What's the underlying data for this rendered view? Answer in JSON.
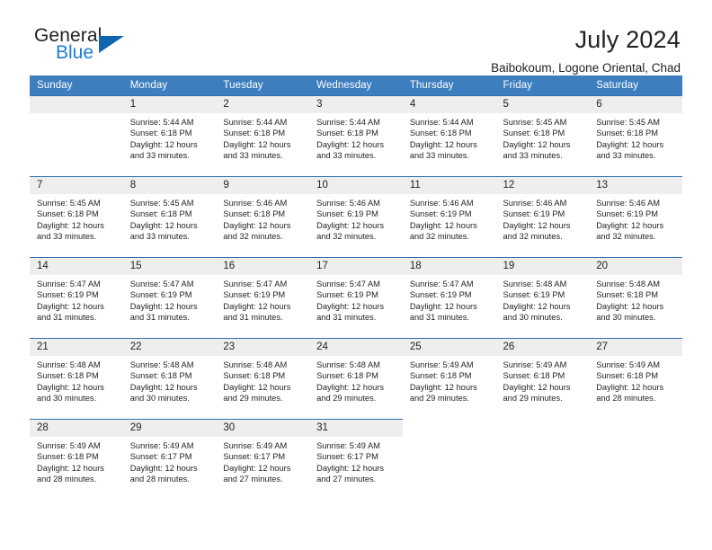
{
  "brand": {
    "name_part1": "General",
    "name_part2": "Blue",
    "triangle_color": "#1065ad",
    "blue_color": "#1a7fd4"
  },
  "header": {
    "title": "July 2024",
    "subtitle": "Baibokoum, Logone Oriental, Chad"
  },
  "theme": {
    "header_row_bg": "#3d7ebf",
    "day_number_bg": "#eeeeee",
    "row_border": "#2f6fb0"
  },
  "labels": {
    "sunrise_prefix": "Sunrise: ",
    "sunset_prefix": "Sunset: ",
    "daylight_prefix": "Daylight: "
  },
  "weekdays": [
    "Sunday",
    "Monday",
    "Tuesday",
    "Wednesday",
    "Thursday",
    "Friday",
    "Saturday"
  ],
  "weeks": [
    [
      {
        "day": "",
        "empty": true
      },
      {
        "day": "1",
        "sunrise": "Sunrise: 5:44 AM",
        "sunset": "Sunset: 6:18 PM",
        "daylight": "Daylight: 12 hours and 33 minutes."
      },
      {
        "day": "2",
        "sunrise": "Sunrise: 5:44 AM",
        "sunset": "Sunset: 6:18 PM",
        "daylight": "Daylight: 12 hours and 33 minutes."
      },
      {
        "day": "3",
        "sunrise": "Sunrise: 5:44 AM",
        "sunset": "Sunset: 6:18 PM",
        "daylight": "Daylight: 12 hours and 33 minutes."
      },
      {
        "day": "4",
        "sunrise": "Sunrise: 5:44 AM",
        "sunset": "Sunset: 6:18 PM",
        "daylight": "Daylight: 12 hours and 33 minutes."
      },
      {
        "day": "5",
        "sunrise": "Sunrise: 5:45 AM",
        "sunset": "Sunset: 6:18 PM",
        "daylight": "Daylight: 12 hours and 33 minutes."
      },
      {
        "day": "6",
        "sunrise": "Sunrise: 5:45 AM",
        "sunset": "Sunset: 6:18 PM",
        "daylight": "Daylight: 12 hours and 33 minutes."
      }
    ],
    [
      {
        "day": "7",
        "sunrise": "Sunrise: 5:45 AM",
        "sunset": "Sunset: 6:18 PM",
        "daylight": "Daylight: 12 hours and 33 minutes."
      },
      {
        "day": "8",
        "sunrise": "Sunrise: 5:45 AM",
        "sunset": "Sunset: 6:18 PM",
        "daylight": "Daylight: 12 hours and 33 minutes."
      },
      {
        "day": "9",
        "sunrise": "Sunrise: 5:46 AM",
        "sunset": "Sunset: 6:18 PM",
        "daylight": "Daylight: 12 hours and 32 minutes."
      },
      {
        "day": "10",
        "sunrise": "Sunrise: 5:46 AM",
        "sunset": "Sunset: 6:19 PM",
        "daylight": "Daylight: 12 hours and 32 minutes."
      },
      {
        "day": "11",
        "sunrise": "Sunrise: 5:46 AM",
        "sunset": "Sunset: 6:19 PM",
        "daylight": "Daylight: 12 hours and 32 minutes."
      },
      {
        "day": "12",
        "sunrise": "Sunrise: 5:46 AM",
        "sunset": "Sunset: 6:19 PM",
        "daylight": "Daylight: 12 hours and 32 minutes."
      },
      {
        "day": "13",
        "sunrise": "Sunrise: 5:46 AM",
        "sunset": "Sunset: 6:19 PM",
        "daylight": "Daylight: 12 hours and 32 minutes."
      }
    ],
    [
      {
        "day": "14",
        "sunrise": "Sunrise: 5:47 AM",
        "sunset": "Sunset: 6:19 PM",
        "daylight": "Daylight: 12 hours and 31 minutes."
      },
      {
        "day": "15",
        "sunrise": "Sunrise: 5:47 AM",
        "sunset": "Sunset: 6:19 PM",
        "daylight": "Daylight: 12 hours and 31 minutes."
      },
      {
        "day": "16",
        "sunrise": "Sunrise: 5:47 AM",
        "sunset": "Sunset: 6:19 PM",
        "daylight": "Daylight: 12 hours and 31 minutes."
      },
      {
        "day": "17",
        "sunrise": "Sunrise: 5:47 AM",
        "sunset": "Sunset: 6:19 PM",
        "daylight": "Daylight: 12 hours and 31 minutes."
      },
      {
        "day": "18",
        "sunrise": "Sunrise: 5:47 AM",
        "sunset": "Sunset: 6:19 PM",
        "daylight": "Daylight: 12 hours and 31 minutes."
      },
      {
        "day": "19",
        "sunrise": "Sunrise: 5:48 AM",
        "sunset": "Sunset: 6:19 PM",
        "daylight": "Daylight: 12 hours and 30 minutes."
      },
      {
        "day": "20",
        "sunrise": "Sunrise: 5:48 AM",
        "sunset": "Sunset: 6:18 PM",
        "daylight": "Daylight: 12 hours and 30 minutes."
      }
    ],
    [
      {
        "day": "21",
        "sunrise": "Sunrise: 5:48 AM",
        "sunset": "Sunset: 6:18 PM",
        "daylight": "Daylight: 12 hours and 30 minutes."
      },
      {
        "day": "22",
        "sunrise": "Sunrise: 5:48 AM",
        "sunset": "Sunset: 6:18 PM",
        "daylight": "Daylight: 12 hours and 30 minutes."
      },
      {
        "day": "23",
        "sunrise": "Sunrise: 5:48 AM",
        "sunset": "Sunset: 6:18 PM",
        "daylight": "Daylight: 12 hours and 29 minutes."
      },
      {
        "day": "24",
        "sunrise": "Sunrise: 5:48 AM",
        "sunset": "Sunset: 6:18 PM",
        "daylight": "Daylight: 12 hours and 29 minutes."
      },
      {
        "day": "25",
        "sunrise": "Sunrise: 5:49 AM",
        "sunset": "Sunset: 6:18 PM",
        "daylight": "Daylight: 12 hours and 29 minutes."
      },
      {
        "day": "26",
        "sunrise": "Sunrise: 5:49 AM",
        "sunset": "Sunset: 6:18 PM",
        "daylight": "Daylight: 12 hours and 29 minutes."
      },
      {
        "day": "27",
        "sunrise": "Sunrise: 5:49 AM",
        "sunset": "Sunset: 6:18 PM",
        "daylight": "Daylight: 12 hours and 28 minutes."
      }
    ],
    [
      {
        "day": "28",
        "sunrise": "Sunrise: 5:49 AM",
        "sunset": "Sunset: 6:18 PM",
        "daylight": "Daylight: 12 hours and 28 minutes."
      },
      {
        "day": "29",
        "sunrise": "Sunrise: 5:49 AM",
        "sunset": "Sunset: 6:17 PM",
        "daylight": "Daylight: 12 hours and 28 minutes."
      },
      {
        "day": "30",
        "sunrise": "Sunrise: 5:49 AM",
        "sunset": "Sunset: 6:17 PM",
        "daylight": "Daylight: 12 hours and 27 minutes."
      },
      {
        "day": "31",
        "sunrise": "Sunrise: 5:49 AM",
        "sunset": "Sunset: 6:17 PM",
        "daylight": "Daylight: 12 hours and 27 minutes."
      },
      {
        "day": "",
        "empty": true
      },
      {
        "day": "",
        "empty": true
      },
      {
        "day": "",
        "empty": true
      }
    ]
  ]
}
